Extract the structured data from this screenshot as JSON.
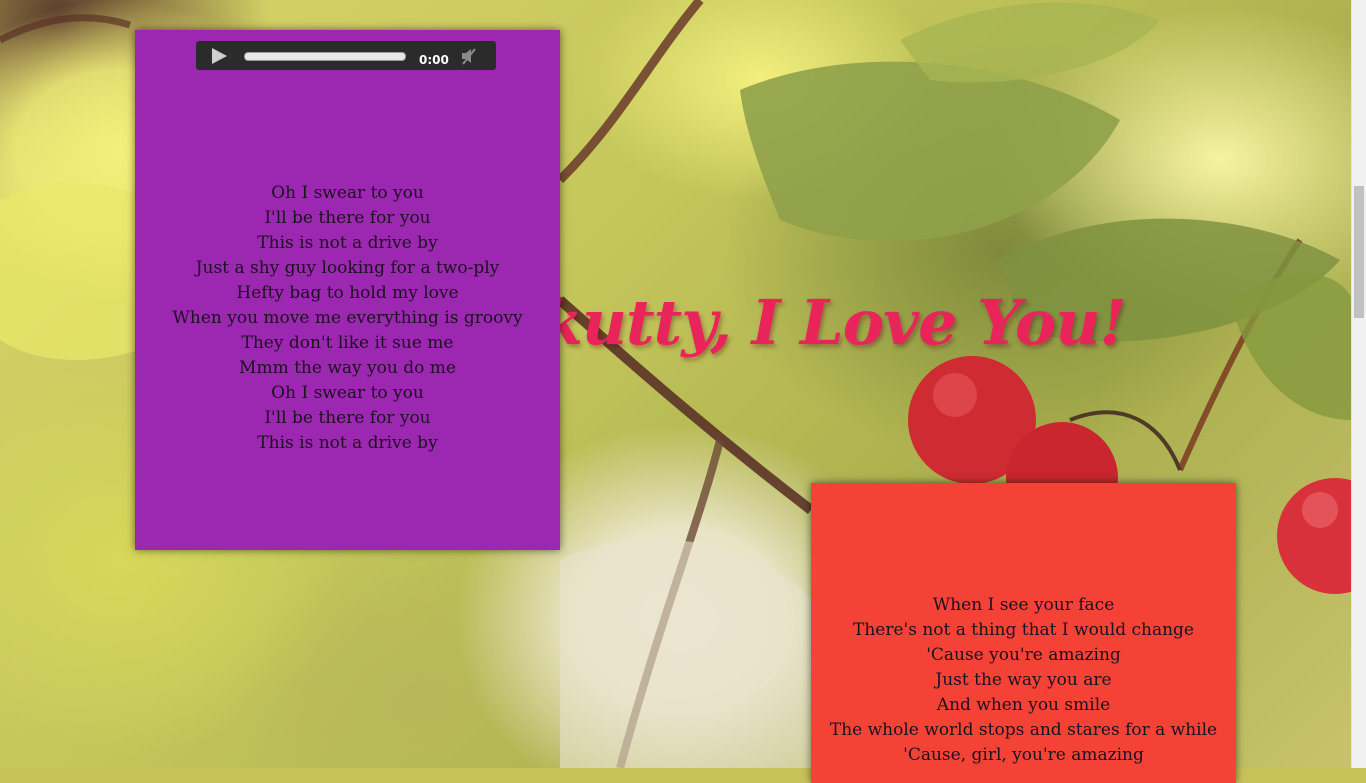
{
  "page": {
    "headline": "kutty, I Love You!"
  },
  "player": {
    "time": "0:00",
    "play_icon": "play-icon",
    "mute_icon": "speaker-muted-icon",
    "progress": 0
  },
  "card_purple": {
    "color": "#9c27b0",
    "lyrics": [
      "Oh I swear to you",
      "I'll be there for you",
      "This is not a drive by",
      "Just a shy guy looking for a two-ply",
      "Hefty bag to hold my love",
      "When you move me everything is groovy",
      "They don't like it sue me",
      "Mmm the way you do me",
      "Oh I swear to you",
      "I'll be there for you",
      "This is not a drive by"
    ]
  },
  "card_red": {
    "color": "#f44336",
    "lyrics": [
      "When I see your face",
      "There's not a thing that I would change",
      "'Cause you're amazing",
      "Just the way you are",
      "And when you smile",
      "The whole world stops and stares for a while",
      "'Cause, girl, you're amazing"
    ]
  },
  "colors": {
    "headline": "#e8245a"
  }
}
